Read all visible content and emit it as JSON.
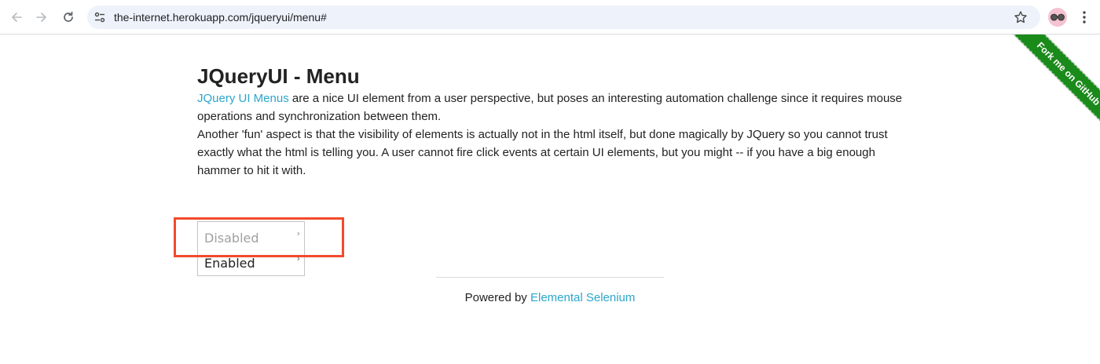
{
  "browser": {
    "url": "the-internet.herokuapp.com/jqueryui/menu#",
    "back_icon": "arrow-left-icon",
    "forward_icon": "arrow-right-icon",
    "reload_icon": "reload-icon",
    "site_info_icon": "tune-icon",
    "bookmark_icon": "star-icon",
    "menu_icon": "kebab-icon"
  },
  "page": {
    "title": "JQueryUI - Menu",
    "para1": {
      "link": "JQuery UI Menus",
      "text": " are a nice UI element from a user perspective, but poses an interesting automation challenge since it requires mouse operations and synchronization between them."
    },
    "para2": "Another 'fun' aspect is that the visibility of elements is actually not in the html itself, but done magically by JQuery so you cannot trust exactly what the html is telling you. A user cannot fire click events at certain UI elements, but you might -- if you have a big enough hammer to hit it with.",
    "menu": {
      "items": [
        {
          "label": "Disabled",
          "disabled": true,
          "caret": "›"
        },
        {
          "label": "Enabled",
          "disabled": false,
          "caret": "›"
        }
      ]
    },
    "footer": {
      "prefix": "Powered by ",
      "link": "Elemental Selenium"
    },
    "ribbon": "Fork me on GitHub"
  },
  "colors": {
    "link": "#2ba6cb",
    "highlight": "#f24a2c",
    "ribbon": "#1a8a1a"
  }
}
